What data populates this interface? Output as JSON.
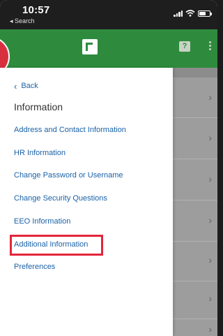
{
  "status_bar": {
    "time": "10:57",
    "back_app": "◂ Search"
  },
  "header": {
    "help_icon_glyph": "?"
  },
  "drawer": {
    "back_label": "Back",
    "back_chevron": "‹",
    "section_title": "Information",
    "items": [
      {
        "label": "Address and Contact Information"
      },
      {
        "label": "HR Information"
      },
      {
        "label": "Change Password or Username"
      },
      {
        "label": "Change Security Questions"
      },
      {
        "label": "EEO Information"
      },
      {
        "label": "Additional Information"
      },
      {
        "label": "Preferences"
      }
    ]
  },
  "background_list": {
    "chevron": "›"
  },
  "colors": {
    "header_green": "#2e8b3d",
    "link_blue": "#1a62a8",
    "highlight_red": "#e3253a"
  }
}
